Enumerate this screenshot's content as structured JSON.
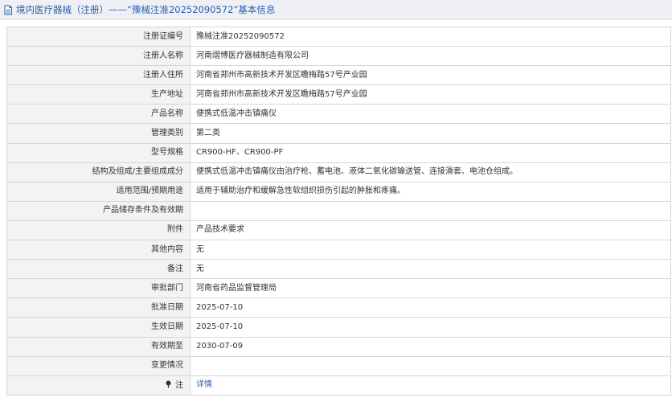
{
  "header": {
    "title": "境内医疗器械（注册）——“豫械注准20252090572”基本信息",
    "icon": "document-icon"
  },
  "rows": [
    {
      "label": "注册证编号",
      "value": "豫械注准20252090572"
    },
    {
      "label": "注册人名称",
      "value": "河南熠博医疗器械制造有限公司"
    },
    {
      "label": "注册人住所",
      "value": "河南省郑州市高新技术开发区瞻梅路57号产业园"
    },
    {
      "label": "生产地址",
      "value": "河南省郑州市高新技术开发区瞻梅路57号产业园"
    },
    {
      "label": "产品名称",
      "value": "便携式低温冲击镇痛仪"
    },
    {
      "label": "管理类别",
      "value": "第二类"
    },
    {
      "label": "型号规格",
      "value": "CR900-HF、CR900-PF"
    },
    {
      "label": "结构及组成/主要组成成分",
      "value": "便携式低温冲击镇痛仪由治疗枪、蓄电池、液体二氧化碳输送管、连接滑套、电池仓组成。"
    },
    {
      "label": "适用范围/预期用途",
      "value": "适用于辅助治疗和缓解急性软组织损伤引起的肿胀和疼痛。"
    },
    {
      "label": "产品储存条件及有效期",
      "value": ""
    },
    {
      "label": "附件",
      "value": "产品技术要求"
    },
    {
      "label": "其他内容",
      "value": "无"
    },
    {
      "label": "备注",
      "value": "无"
    },
    {
      "label": "审批部门",
      "value": "河南省药品监督管理局"
    },
    {
      "label": "批准日期",
      "value": "2025-07-10"
    },
    {
      "label": "生效日期",
      "value": "2025-07-10"
    },
    {
      "label": "有效期至",
      "value": "2030-07-09"
    },
    {
      "label": "变更情况",
      "value": ""
    }
  ],
  "note_row": {
    "label": "注",
    "icon": "pin-icon",
    "link": "详情"
  }
}
